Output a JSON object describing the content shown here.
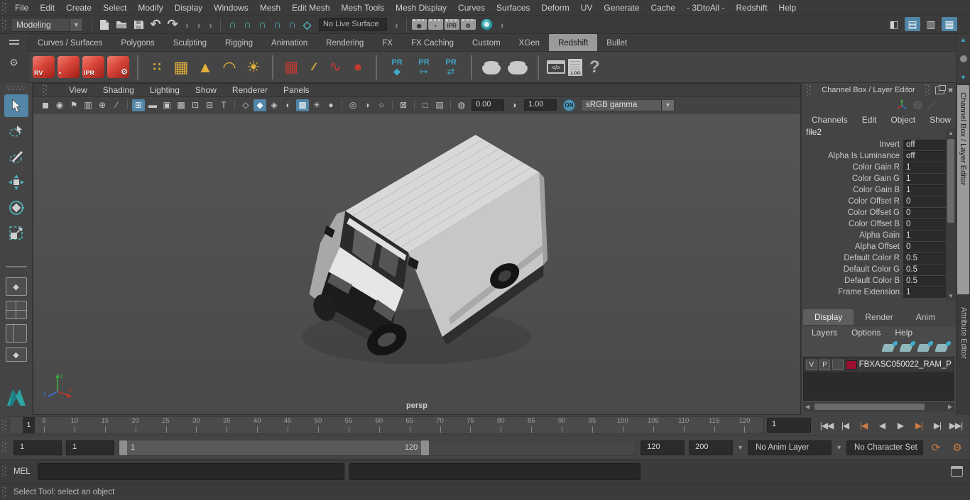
{
  "menubar": {
    "items": [
      "File",
      "Edit",
      "Create",
      "Select",
      "Modify",
      "Display",
      "Windows",
      "Mesh",
      "Edit Mesh",
      "Mesh Tools",
      "Mesh Display",
      "Curves",
      "Surfaces",
      "Deform",
      "UV",
      "Generate",
      "Cache",
      "- 3DtoAll -",
      "Redshift",
      "Help"
    ]
  },
  "toolbar": {
    "menu_set": "Modeling",
    "live_surface": "No Live Surface",
    "undo_glyph": "↶",
    "redo_glyph": "↷",
    "chevron_glyph": "›",
    "snap_icons": [
      {
        "name": "snap-to-grids-icon",
        "g": "∩"
      },
      {
        "name": "snap-to-curves-icon",
        "g": "∩"
      },
      {
        "name": "snap-to-points-icon",
        "g": "∩"
      },
      {
        "name": "snap-to-projected-center-icon",
        "g": "∩"
      },
      {
        "name": "snap-to-view-planes-icon",
        "g": "∩"
      },
      {
        "name": "make-live-icon",
        "g": "◇"
      }
    ],
    "render_icons": [
      {
        "name": "render-view-icon",
        "g": "◉"
      },
      {
        "name": "render-current-frame-icon",
        "g": "▪"
      },
      {
        "name": "ipr-render-icon",
        "g": "IPR"
      },
      {
        "name": "render-settings-icon",
        "g": "⚙"
      }
    ],
    "panel_toggles": [
      {
        "name": "modeling-toolkit-toggle",
        "g": "◧"
      },
      {
        "name": "attribute-editor-toggle",
        "g": "▤",
        "cls": "on"
      },
      {
        "name": "tool-settings-toggle",
        "g": "▥"
      },
      {
        "name": "channel-box-toggle",
        "g": "▦",
        "cls": "on"
      }
    ]
  },
  "shelf": {
    "tabs": [
      {
        "label": "Curves / Surfaces"
      },
      {
        "label": "Polygons"
      },
      {
        "label": "Sculpting"
      },
      {
        "label": "Rigging"
      },
      {
        "label": "Animation"
      },
      {
        "label": "Rendering"
      },
      {
        "label": "FX"
      },
      {
        "label": "FX Caching"
      },
      {
        "label": "Custom"
      },
      {
        "label": "XGen"
      },
      {
        "label": "Redshift",
        "active": true
      },
      {
        "label": "Bullet"
      }
    ],
    "labels": {
      "rv": "RV",
      "clap": "▪",
      "ipr": "IPR",
      "gear": "⚙",
      "quad": "∷",
      "grid": "▦",
      "cone": "▲",
      "dome": "◠",
      "sun": "☀",
      "proxybox": "▦",
      "hair": "∕∕∕",
      "curve": "∿",
      "sphere": "●",
      "pr": "PR",
      "pr_cube": "◆",
      "pr_export": "↦",
      "pr_convert": "⇄",
      "code": "</>",
      "log": ".LOG",
      "help": "?"
    }
  },
  "viewport": {
    "menu": [
      "View",
      "Shading",
      "Lighting",
      "Show",
      "Renderer",
      "Panels"
    ],
    "icons": [
      {
        "name": "select-camera-icon",
        "g": "◼"
      },
      {
        "name": "camera-attributes-icon",
        "g": "◉"
      },
      {
        "name": "bookmark-icon",
        "g": "⚑"
      },
      {
        "name": "image-plane-icon",
        "g": "▥"
      },
      {
        "name": "pan-zoom-icon",
        "g": "⊕"
      },
      {
        "name": "grease-pencil-icon",
        "g": "∕"
      },
      {
        "name": "separator",
        "g": "",
        "cls": "vsep"
      },
      {
        "name": "grid-icon",
        "g": "⊞",
        "cls": "active"
      },
      {
        "name": "film-gate-icon",
        "g": "▬"
      },
      {
        "name": "resolution-gate-icon",
        "g": "▣"
      },
      {
        "name": "gate-mask-icon",
        "g": "▩"
      },
      {
        "name": "field-chart-icon",
        "g": "⊡"
      },
      {
        "name": "safe-action-icon",
        "g": "⊟"
      },
      {
        "name": "safe-title-icon",
        "g": "T"
      },
      {
        "name": "separator",
        "g": "",
        "cls": "vsep"
      },
      {
        "name": "wireframe-icon",
        "g": "◇"
      },
      {
        "name": "smooth-shade-icon",
        "g": "◆",
        "cls": "active"
      },
      {
        "name": "wireframe-on-shaded-icon",
        "g": "◈"
      },
      {
        "name": "default-material-icon",
        "g": "◐"
      },
      {
        "name": "textured-icon",
        "g": "▩",
        "cls": "active"
      },
      {
        "name": "lights-icon",
        "g": "☀"
      },
      {
        "name": "shadows-icon",
        "g": "●"
      },
      {
        "name": "separator",
        "g": "",
        "cls": "vsep"
      },
      {
        "name": "ao-icon",
        "g": "◎"
      },
      {
        "name": "motion-blur-icon",
        "g": "◑"
      },
      {
        "name": "anti-alias-icon",
        "g": "○"
      },
      {
        "name": "separator",
        "g": "",
        "cls": "vsep"
      },
      {
        "name": "isolate-select-icon",
        "g": "⊠"
      },
      {
        "name": "separator",
        "g": "",
        "cls": "vsep"
      },
      {
        "name": "copy-view-icon",
        "g": "□"
      },
      {
        "name": "paste-view-icon",
        "g": "▤"
      },
      {
        "name": "separator",
        "g": "",
        "cls": "vsep"
      },
      {
        "name": "exposure-icon",
        "g": "◍"
      }
    ],
    "exposure": "0.00",
    "contrast": "1.00",
    "on_badge": "ON",
    "gamma": "sRGB gamma",
    "camera_label": "persp",
    "axis": {
      "x": "x",
      "y": "y",
      "z": "z"
    }
  },
  "channel_box": {
    "title": "Channel Box / Layer Editor",
    "menu": [
      "Channels",
      "Edit",
      "Object",
      "Show"
    ],
    "node": "file2",
    "attributes": [
      {
        "label": "Invert",
        "value": "off"
      },
      {
        "label": "Alpha Is Luminance",
        "value": "off"
      },
      {
        "label": "Color Gain R",
        "value": "1"
      },
      {
        "label": "Color Gain G",
        "value": "1"
      },
      {
        "label": "Color Gain B",
        "value": "1"
      },
      {
        "label": "Color Offset R",
        "value": "0"
      },
      {
        "label": "Color Offset G",
        "value": "0"
      },
      {
        "label": "Color Offset B",
        "value": "0"
      },
      {
        "label": "Alpha Gain",
        "value": "1"
      },
      {
        "label": "Alpha Offset",
        "value": "0"
      },
      {
        "label": "Default Color R",
        "value": "0.5"
      },
      {
        "label": "Default Color G",
        "value": "0.5"
      },
      {
        "label": "Default Color B",
        "value": "0.5"
      },
      {
        "label": "Frame Extension",
        "value": "1"
      }
    ],
    "side_tabs": [
      {
        "label": "Channel Box / Layer Editor",
        "active": true
      },
      {
        "label": "Attribute Editor"
      }
    ]
  },
  "layer_editor": {
    "tabs": [
      {
        "label": "Display",
        "active": true
      },
      {
        "label": "Render"
      },
      {
        "label": "Anim"
      }
    ],
    "menu": [
      "Layers",
      "Options",
      "Help"
    ],
    "layer": {
      "visibility": "V",
      "playback": "P",
      "name": "FBXASC050022_RAM_P",
      "swatch_color": "#9b1030"
    }
  },
  "timeline": {
    "ticks": [
      "5",
      "10",
      "15",
      "20",
      "25",
      "30",
      "35",
      "40",
      "45",
      "50",
      "55",
      "60",
      "65",
      "70",
      "75",
      "80",
      "85",
      "90",
      "95",
      "100",
      "105",
      "110",
      "115",
      "120"
    ],
    "playhead_frame": "1",
    "current_frame": "1",
    "playback_buttons": [
      {
        "name": "go-to-start-button",
        "g": "|◀◀"
      },
      {
        "name": "step-back-frame-button",
        "g": "|◀"
      },
      {
        "name": "step-back-key-button",
        "g": "|◀",
        "cls": "key"
      },
      {
        "name": "play-backwards-button",
        "g": "◀"
      },
      {
        "name": "play-forwards-button",
        "g": "▶"
      },
      {
        "name": "step-forward-key-button",
        "g": "▶|",
        "cls": "key"
      },
      {
        "name": "step-forward-frame-button",
        "g": "▶|"
      },
      {
        "name": "go-to-end-button",
        "g": "▶▶|"
      }
    ]
  },
  "range_slider": {
    "anim_start": "1",
    "play_start": "1",
    "handle_start": "1",
    "handle_end": "120",
    "play_end": "120",
    "anim_end": "200",
    "anim_layer": "No Anim Layer",
    "character_set": "No Character Set"
  },
  "command_line": {
    "label": "MEL"
  },
  "help_line": {
    "text": "Select Tool: select an object"
  },
  "colors": {
    "accent_blue": "#5285a6",
    "teal": "#48b0ba",
    "redshift_red": "#c23a32",
    "shelf_yellow": "#e2b13c",
    "key_orange": "#cd7b3e",
    "layer_swatch": "#9b1030",
    "viewport_bg": "#4e4e4e"
  }
}
